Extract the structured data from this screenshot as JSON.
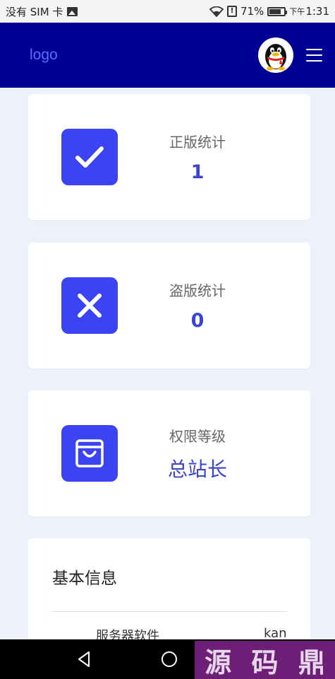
{
  "status_bar": {
    "carrier": "没有 SIM 卡",
    "battery_percent": "71%",
    "alert_symbol": "!",
    "ampm": "下午",
    "time": "1:31"
  },
  "header": {
    "logo": "logo",
    "avatar_icon": "qq-penguin-icon",
    "menu_icon": "hamburger-menu-icon"
  },
  "cards": [
    {
      "label": "正版统计",
      "value": "1",
      "icon": "checkmark-icon"
    },
    {
      "label": "盗版统计",
      "value": "0",
      "icon": "close-x-icon"
    },
    {
      "label": "权限等级",
      "value": "总站长",
      "icon": "shopping-bag-icon"
    }
  ],
  "info": {
    "title": "基本信息",
    "rows": [
      {
        "key": "服务器软件",
        "value": "kan"
      }
    ]
  },
  "nav_bar": {
    "buttons": [
      "back",
      "home",
      "recents"
    ]
  },
  "watermark": {
    "chars": [
      "源",
      "码",
      "鼎"
    ]
  },
  "colors": {
    "header_bg": "#000095",
    "accent": "#3a44f2",
    "page_bg": "#edf1fa",
    "watermark_bg": "#6d1f78"
  }
}
